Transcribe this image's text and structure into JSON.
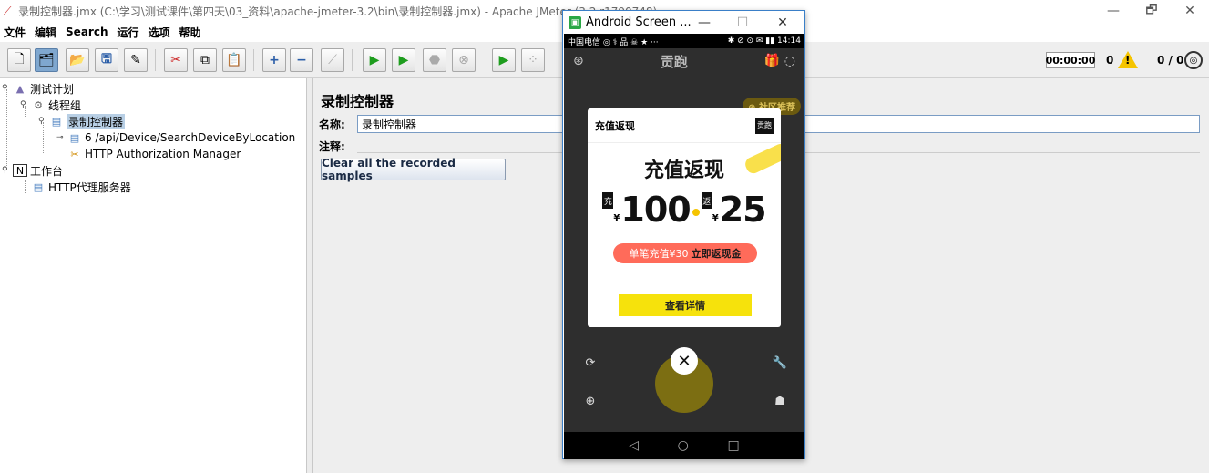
{
  "window": {
    "title": "录制控制器.jmx (C:\\学习\\测试课件\\第四天\\03_资料\\apache-jmeter-3.2\\bin\\录制控制器.jmx) - Apache JMeter (3.2 r1790748)",
    "minimize": "—",
    "maximize": "🗗",
    "close": "✕"
  },
  "menu": [
    "文件",
    "编辑",
    "Search",
    "运行",
    "选项",
    "帮助"
  ],
  "status": {
    "timer": "00:00:00",
    "warnings": "0",
    "threads": "0 / 0"
  },
  "tree": {
    "test_plan": "测试计划",
    "thread_group": "线程组",
    "recording_controller": "录制控制器",
    "sampler": "6 /api/Device/SearchDeviceByLocation",
    "auth_manager": "HTTP Authorization Manager",
    "workbench": "工作台",
    "proxy_server": "HTTP代理服务器"
  },
  "panel": {
    "title": "录制控制器",
    "name_label": "名称:",
    "name_value": "录制控制器",
    "comment_label": "注释:",
    "clear_button": "Clear all the recorded samples"
  },
  "android": {
    "window_title": "Android Screen ...",
    "minimize": "—",
    "maximize": "☐",
    "close": "✕",
    "status_left": "中国电信 ◎ ⚕ 品 ☠ ★ ···",
    "status_right": "✱ ⊘ ⊙ ✉ ▮▮ 14:14",
    "brand": "贡跑",
    "community_tag": "⊕ 社区推荐",
    "popup_header": "充值返现",
    "popup_logo": "贡跑",
    "promo_title": "充值返现",
    "tag_charge": "充",
    "tag_return": "返",
    "currency": "¥",
    "amount_charge": "100",
    "amount_return": "25",
    "pill_text": "单笔充值¥30",
    "pill_bold": "立即返现金",
    "detail_button": "查看详情",
    "close_symbol": "✕",
    "nav_back": "◁",
    "nav_home": "○",
    "nav_recent": "□"
  }
}
